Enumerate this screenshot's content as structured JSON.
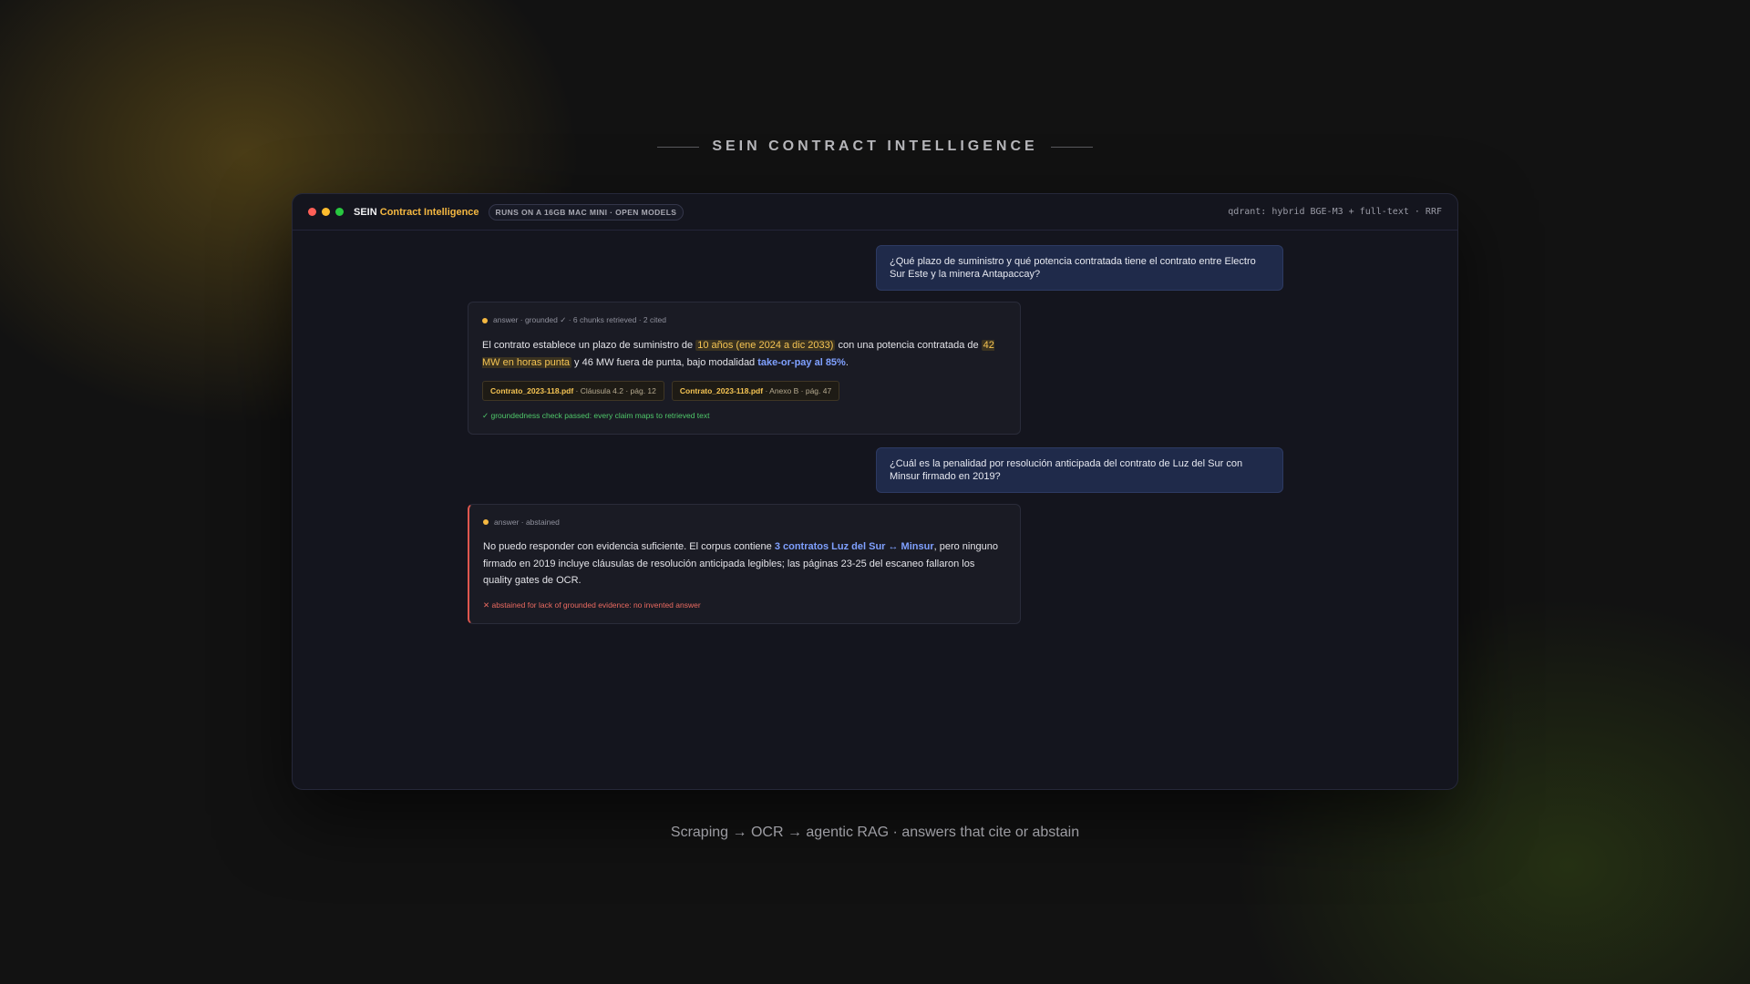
{
  "heading": "SEIN CONTRACT INTELLIGENCE",
  "window": {
    "brand_prefix": "SEIN",
    "brand_accent": "Contract Intelligence",
    "badge": "RUNS ON A 16GB MAC MINI · OPEN MODELS",
    "engine": "qdrant: hybrid BGE-M3 + full-text · RRF"
  },
  "messages": [
    {
      "question": "¿Qué plazo de suministro y qué potencia contratada tiene el contrato entre Electro Sur Este y la minera Antapaccay?",
      "meta": "answer · grounded ✓ · 6 chunks retrieved · 2 cited",
      "text": {
        "t1": "El contrato establece un plazo de suministro de ",
        "hl1": "10 años (ene 2024 a dic 2033)",
        "t2": " con una potencia contratada de ",
        "hl2": "42 MW en horas punta",
        "t3": " y 46 MW fuera de punta, bajo modalidad ",
        "link": "take-or-pay al 85%",
        "t4": "."
      },
      "citations": [
        {
          "file": "Contrato_2023-118.pdf",
          "detail": " · Cláusula 4.2 · pág. 12"
        },
        {
          "file": "Contrato_2023-118.pdf",
          "detail": " · Anexo B · pág. 47"
        }
      ],
      "check": "✓ groundedness check passed: every claim maps to retrieved text"
    },
    {
      "question": "¿Cuál es la penalidad por resolución anticipada del contrato de Luz del Sur con Minsur firmado en 2019?",
      "meta": "answer · abstained",
      "text": {
        "t1": "No puedo responder con evidencia suficiente. El corpus contiene ",
        "link": "3 contratos Luz del Sur ↔ Minsur",
        "t2": ", pero ninguno firmado en 2019 incluye cláusulas de resolución anticipada legibles; las páginas 23-25 del escaneo fallaron los quality gates de OCR."
      },
      "check": "✕ abstained for lack of grounded evidence: no invented answer"
    }
  ],
  "caption": "Scraping → OCR → agentic RAG · answers that cite or abstain",
  "colors": {
    "accent": "#f5b841",
    "link": "#7fa0ff",
    "pass": "#4fc86a",
    "fail": "#ea6a60",
    "user_bubble": "#1f2a4a"
  }
}
